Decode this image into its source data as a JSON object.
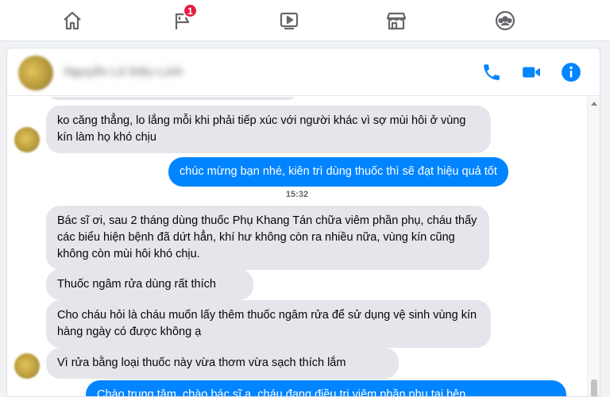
{
  "nav": {
    "notification_count": "1",
    "icons": [
      "home-icon",
      "flag-icon",
      "watch-icon",
      "marketplace-icon",
      "groups-icon"
    ]
  },
  "header": {
    "contact_name": "Nguyễn Lê Diệu Linh"
  },
  "messages": {
    "m1": "ko căng thẳng, lo lắng mỗi khi phải tiếp xúc với người khác vì sợ mùi hôi ở vùng kín làm họ khó chịu",
    "m2": "chúc mừng bạn nhé, kiên trì dùng thuốc thì sẽ đạt hiệu quả tốt",
    "timestamp": "15:32",
    "m3": "Bác sĩ ơi, sau 2 tháng dùng thuốc Phụ Khang Tán chữa viêm phần phụ, cháu thấy các biểu hiện bệnh đã dứt hẳn, khí hư không còn ra nhiều nữa, vùng kín cũng không còn mùi hôi khó chịu.",
    "m4": "Thuốc ngâm rửa dùng rất thích",
    "m5": "Cho cháu hỏi là cháu muốn lấy thêm thuốc ngâm rửa để sử dụng vệ sinh vùng kín hàng ngày có được không ạ",
    "m6": "Vì rửa bằng loại thuốc này vừa thơm vừa sạch thích lắm",
    "m7": "Chào trung tâm, chào bác sĩ ạ, cháu đang điều trị viêm phần phụ tại bên"
  },
  "colors": {
    "accent": "#0084ff",
    "incoming_bubble": "#e4e6eb",
    "badge": "#e41e3f"
  }
}
